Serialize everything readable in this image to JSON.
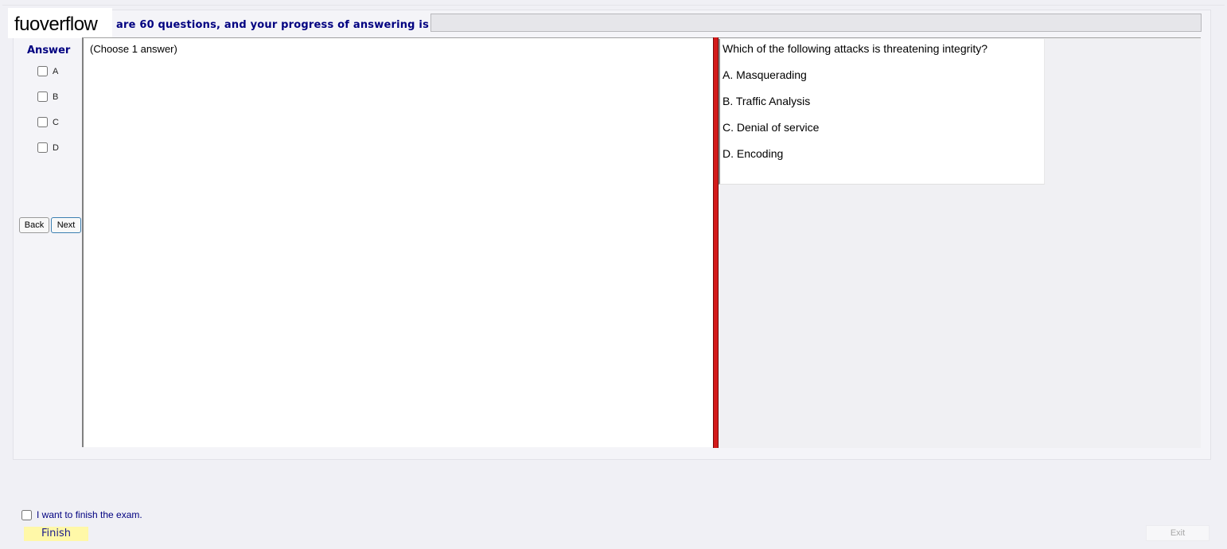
{
  "header": {
    "logo_text": "fuoverflow",
    "progress_text": "are 60 questions, and your progress of answering is",
    "progress_fraction": 0
  },
  "answer_panel": {
    "title": "Answer",
    "options": [
      "A",
      "B",
      "C",
      "D"
    ],
    "back_label": "Back",
    "next_label": "Next"
  },
  "content": {
    "choose_hint": "(Choose 1 answer)"
  },
  "question": {
    "text": "Which of the following attacks is threatening integrity?",
    "choices": [
      "A.  Masquerading",
      "B.  Traffic Analysis",
      "C.  Denial of service",
      "D.  Encoding"
    ]
  },
  "footer": {
    "finish_check_label": "I want to finish the exam.",
    "finish_label": "Finish",
    "exit_label": "Exit"
  },
  "colors": {
    "accent_text": "#000080",
    "splitter": "#d31a1a",
    "finish_bg": "#fff8a8"
  }
}
